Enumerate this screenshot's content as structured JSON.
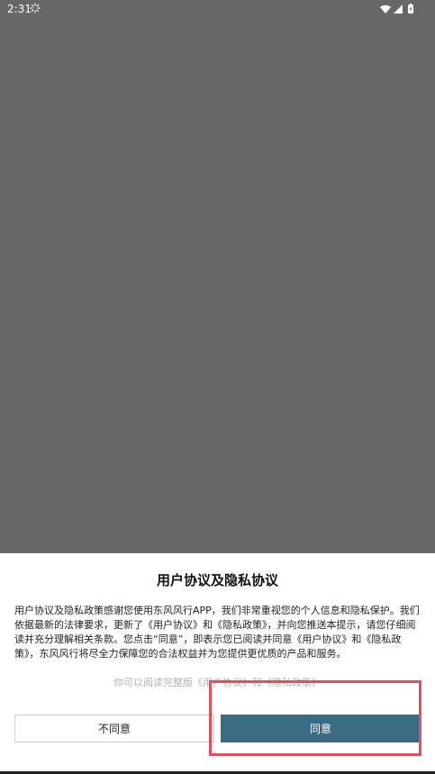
{
  "status_bar": {
    "time": "2:31"
  },
  "dialog": {
    "title": "用户协议及隐私协议",
    "body": "用户协议及隐私政策感谢您使用东风风行APP，我们非常重视您的个人信息和隐私保护。我们依据最新的法律要求，更新了《用户协议》和《隐私政策》，并向您推送本提示，请您仔细阅读并充分理解相关条款。您点击“同意”，即表示您已阅读并同意《用户协议》和《隐私政策》，东风风行将尽全力保障您的合法权益并为您提供更优质的产品和服务。",
    "full_version_text": "你可以阅读完整版《用户协议》和《隐私政策》",
    "disagree_label": "不同意",
    "agree_label": "同意"
  },
  "colors": {
    "overlay": "#676767",
    "agree_button": "#3a6b82",
    "highlight": "#e0515f"
  },
  "icons": [
    "loading-spinner-icon",
    "wifi-icon",
    "cellular-signal-icon",
    "battery-icon"
  ]
}
